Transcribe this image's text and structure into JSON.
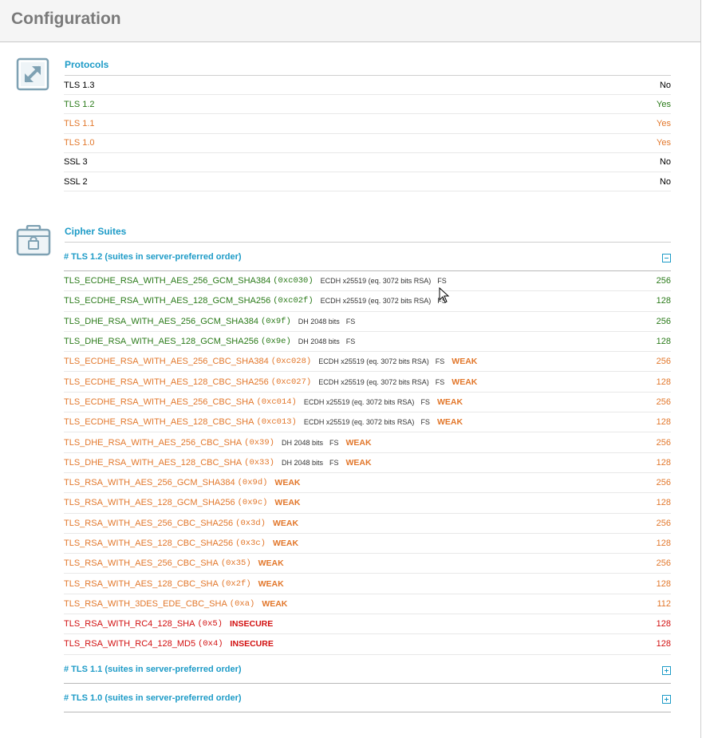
{
  "page_title": "Configuration",
  "colors": {
    "accent": "#1d9bc7",
    "green": "#2a7a19",
    "orange": "#e2772b",
    "red": "#d21010"
  },
  "protocols": {
    "icon": "expand-arrows-icon",
    "title": "Protocols",
    "rows": [
      {
        "name": "TLS 1.3",
        "value": "No",
        "status": "black"
      },
      {
        "name": "TLS 1.2",
        "value": "Yes",
        "status": "green"
      },
      {
        "name": "TLS 1.1",
        "value": "Yes",
        "status": "orange"
      },
      {
        "name": "TLS 1.0",
        "value": "Yes",
        "status": "orange"
      },
      {
        "name": "SSL 3",
        "value": "No",
        "status": "black"
      },
      {
        "name": "SSL 2",
        "value": "No",
        "status": "black"
      }
    ]
  },
  "cipher_suites": {
    "icon": "lock-box-icon",
    "title": "Cipher Suites",
    "groups": [
      {
        "label": "# TLS 1.2 (suites in server-preferred order)",
        "expanded": true,
        "toggle_icon": "collapse-minus-icon",
        "suites": [
          {
            "name": "TLS_ECDHE_RSA_WITH_AES_256_GCM_SHA384",
            "code": "(0xc030)",
            "kx": "ECDH x25519 (eq. 3072 bits RSA)",
            "fs": "FS",
            "flag": "",
            "bits": "256",
            "status": "green"
          },
          {
            "name": "TLS_ECDHE_RSA_WITH_AES_128_GCM_SHA256",
            "code": "(0xc02f)",
            "kx": "ECDH x25519 (eq. 3072 bits RSA)",
            "fs": "FS",
            "flag": "",
            "bits": "128",
            "status": "green"
          },
          {
            "name": "TLS_DHE_RSA_WITH_AES_256_GCM_SHA384",
            "code": "(0x9f)",
            "kx": "DH 2048 bits",
            "fs": "FS",
            "flag": "",
            "bits": "256",
            "status": "green"
          },
          {
            "name": "TLS_DHE_RSA_WITH_AES_128_GCM_SHA256",
            "code": "(0x9e)",
            "kx": "DH 2048 bits",
            "fs": "FS",
            "flag": "",
            "bits": "128",
            "status": "green"
          },
          {
            "name": "TLS_ECDHE_RSA_WITH_AES_256_CBC_SHA384",
            "code": "(0xc028)",
            "kx": "ECDH x25519 (eq. 3072 bits RSA)",
            "fs": "FS",
            "flag": "WEAK",
            "bits": "256",
            "status": "orange"
          },
          {
            "name": "TLS_ECDHE_RSA_WITH_AES_128_CBC_SHA256",
            "code": "(0xc027)",
            "kx": "ECDH x25519 (eq. 3072 bits RSA)",
            "fs": "FS",
            "flag": "WEAK",
            "bits": "128",
            "status": "orange"
          },
          {
            "name": "TLS_ECDHE_RSA_WITH_AES_256_CBC_SHA",
            "code": "(0xc014)",
            "kx": "ECDH x25519 (eq. 3072 bits RSA)",
            "fs": "FS",
            "flag": "WEAK",
            "bits": "256",
            "status": "orange"
          },
          {
            "name": "TLS_ECDHE_RSA_WITH_AES_128_CBC_SHA",
            "code": "(0xc013)",
            "kx": "ECDH x25519 (eq. 3072 bits RSA)",
            "fs": "FS",
            "flag": "WEAK",
            "bits": "128",
            "status": "orange"
          },
          {
            "name": "TLS_DHE_RSA_WITH_AES_256_CBC_SHA",
            "code": "(0x39)",
            "kx": "DH 2048 bits",
            "fs": "FS",
            "flag": "WEAK",
            "bits": "256",
            "status": "orange"
          },
          {
            "name": "TLS_DHE_RSA_WITH_AES_128_CBC_SHA",
            "code": "(0x33)",
            "kx": "DH 2048 bits",
            "fs": "FS",
            "flag": "WEAK",
            "bits": "128",
            "status": "orange"
          },
          {
            "name": "TLS_RSA_WITH_AES_256_GCM_SHA384",
            "code": "(0x9d)",
            "kx": "",
            "fs": "",
            "flag": "WEAK",
            "bits": "256",
            "status": "orange"
          },
          {
            "name": "TLS_RSA_WITH_AES_128_GCM_SHA256",
            "code": "(0x9c)",
            "kx": "",
            "fs": "",
            "flag": "WEAK",
            "bits": "128",
            "status": "orange"
          },
          {
            "name": "TLS_RSA_WITH_AES_256_CBC_SHA256",
            "code": "(0x3d)",
            "kx": "",
            "fs": "",
            "flag": "WEAK",
            "bits": "256",
            "status": "orange"
          },
          {
            "name": "TLS_RSA_WITH_AES_128_CBC_SHA256",
            "code": "(0x3c)",
            "kx": "",
            "fs": "",
            "flag": "WEAK",
            "bits": "128",
            "status": "orange"
          },
          {
            "name": "TLS_RSA_WITH_AES_256_CBC_SHA",
            "code": "(0x35)",
            "kx": "",
            "fs": "",
            "flag": "WEAK",
            "bits": "256",
            "status": "orange"
          },
          {
            "name": "TLS_RSA_WITH_AES_128_CBC_SHA",
            "code": "(0x2f)",
            "kx": "",
            "fs": "",
            "flag": "WEAK",
            "bits": "128",
            "status": "orange"
          },
          {
            "name": "TLS_RSA_WITH_3DES_EDE_CBC_SHA",
            "code": "(0xa)",
            "kx": "",
            "fs": "",
            "flag": "WEAK",
            "bits": "112",
            "status": "orange"
          },
          {
            "name": "TLS_RSA_WITH_RC4_128_SHA",
            "code": "(0x5)",
            "kx": "",
            "fs": "",
            "flag": "INSECURE",
            "bits": "128",
            "status": "red"
          },
          {
            "name": "TLS_RSA_WITH_RC4_128_MD5",
            "code": "(0x4)",
            "kx": "",
            "fs": "",
            "flag": "INSECURE",
            "bits": "128",
            "status": "red"
          }
        ]
      },
      {
        "label": "# TLS 1.1 (suites in server-preferred order)",
        "expanded": false,
        "toggle_icon": "expand-plus-icon",
        "suites": []
      },
      {
        "label": "# TLS 1.0 (suites in server-preferred order)",
        "expanded": false,
        "toggle_icon": "expand-plus-icon",
        "suites": []
      }
    ]
  }
}
